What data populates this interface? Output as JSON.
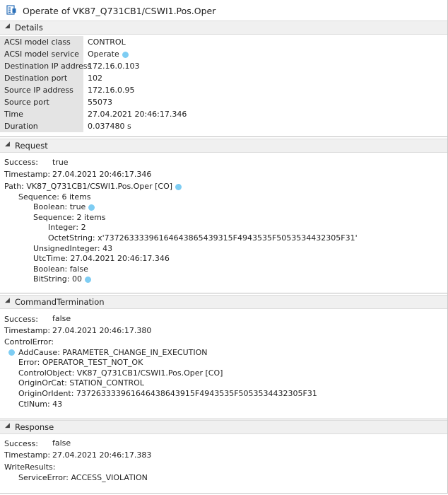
{
  "window": {
    "title": "Operate of VK87_Q731CB1/CSWI1.Pos.Oper"
  },
  "details": {
    "header": "Details",
    "rows": [
      {
        "key": "ACSI model class",
        "value": "CONTROL"
      },
      {
        "key": "ACSI model service",
        "value": "Operate"
      },
      {
        "key": "Destination IP address",
        "value": "172.16.0.103"
      },
      {
        "key": "Destination port",
        "value": "102"
      },
      {
        "key": "Source IP address",
        "value": "172.16.0.95"
      },
      {
        "key": "Source port",
        "value": "55073"
      },
      {
        "key": "Time",
        "value": "27.04.2021 20:46:17.346"
      },
      {
        "key": "Duration",
        "value": "0.037480 s"
      }
    ]
  },
  "request": {
    "header": "Request",
    "success_label": "Success:",
    "success_value": "true",
    "timestamp_label": "Timestamp:",
    "timestamp_value": "27.04.2021 20:46:17.346",
    "path": "Path: VK87_Q731CB1/CSWI1.Pos.Oper [CO]",
    "tree": [
      "Sequence: 6 items",
      "Boolean: true",
      "Sequence: 2 items",
      "Integer: 2",
      "OctetString: x'73726333396164643865439315F4943535F5053534432305F31'",
      "UnsignedInteger: 43",
      "UtcTime: 27.04.2021 20:46:17.346",
      "Boolean: false",
      "BitString: 00"
    ]
  },
  "termination": {
    "header": "CommandTermination",
    "success_label": "Success:",
    "success_value": "false",
    "timestamp_label": "Timestamp:",
    "timestamp_value": "27.04.2021 20:46:17.380",
    "control_error": "ControlError:",
    "items": [
      "AddCause: PARAMETER_CHANGE_IN_EXECUTION",
      "Error: OPERATOR_TEST_NOT_OK",
      "ControlObject: VK87_Q731CB1/CSWI1.Pos.Oper [CO]",
      "OriginOrCat: STATION_CONTROL",
      "OriginOrIdent: 737263333961646438643915F4943535F5053534432305F31",
      "CtlNum: 43"
    ]
  },
  "response": {
    "header": "Response",
    "success_label": "Success:",
    "success_value": "false",
    "timestamp_label": "Timestamp:",
    "timestamp_value": "27.04.2021 20:46:17.383",
    "write_results": "WriteResults:",
    "service_error": "ServiceError: ACCESS_VIOLATION"
  },
  "icons": {
    "app": "form-icon",
    "collapse": "triangle-collapse-icon",
    "marker": "dot-marker-icon"
  },
  "colors": {
    "marker": "#7ecdf3",
    "header_bg": "#f0f0f0",
    "key_bg": "#e4e4e4"
  }
}
